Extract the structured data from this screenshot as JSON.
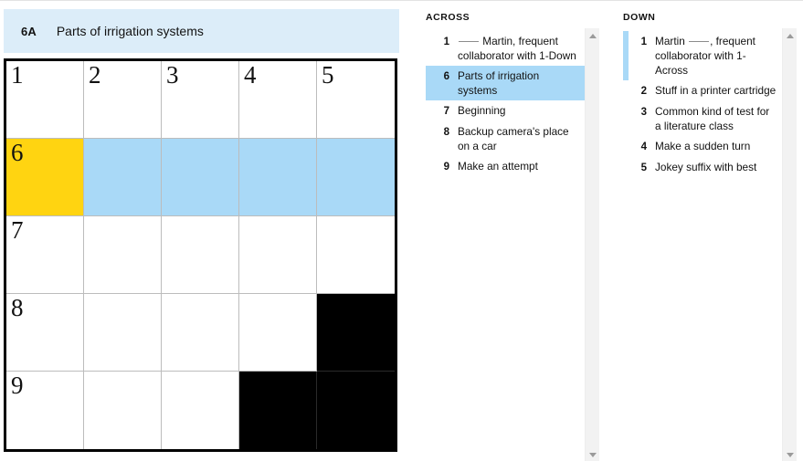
{
  "banner": {
    "number": "6A",
    "text": "Parts of irrigation systems"
  },
  "grid": {
    "rows": 5,
    "cols": 5,
    "cursor_color": "#FFD411",
    "word_highlight_color": "#A9D9F7",
    "block_color": "#000000",
    "cells": [
      [
        {
          "num": "1",
          "state": "open",
          "letter": ""
        },
        {
          "num": "2",
          "state": "open",
          "letter": ""
        },
        {
          "num": "3",
          "state": "open",
          "letter": ""
        },
        {
          "num": "4",
          "state": "open",
          "letter": ""
        },
        {
          "num": "5",
          "state": "open",
          "letter": ""
        }
      ],
      [
        {
          "num": "6",
          "state": "cursor",
          "letter": ""
        },
        {
          "num": "",
          "state": "word",
          "letter": ""
        },
        {
          "num": "",
          "state": "word",
          "letter": ""
        },
        {
          "num": "",
          "state": "word",
          "letter": ""
        },
        {
          "num": "",
          "state": "word",
          "letter": ""
        }
      ],
      [
        {
          "num": "7",
          "state": "open",
          "letter": ""
        },
        {
          "num": "",
          "state": "open",
          "letter": ""
        },
        {
          "num": "",
          "state": "open",
          "letter": ""
        },
        {
          "num": "",
          "state": "open",
          "letter": ""
        },
        {
          "num": "",
          "state": "open",
          "letter": ""
        }
      ],
      [
        {
          "num": "8",
          "state": "open",
          "letter": ""
        },
        {
          "num": "",
          "state": "open",
          "letter": ""
        },
        {
          "num": "",
          "state": "open",
          "letter": ""
        },
        {
          "num": "",
          "state": "open",
          "letter": ""
        },
        {
          "num": "",
          "state": "block",
          "letter": ""
        }
      ],
      [
        {
          "num": "9",
          "state": "open",
          "letter": ""
        },
        {
          "num": "",
          "state": "open",
          "letter": ""
        },
        {
          "num": "",
          "state": "open",
          "letter": ""
        },
        {
          "num": "",
          "state": "block",
          "letter": ""
        },
        {
          "num": "",
          "state": "block",
          "letter": ""
        }
      ]
    ]
  },
  "across": {
    "heading": "ACROSS",
    "clues": [
      {
        "num": "1",
        "text": "Martin, frequent collaborator with 1-Down",
        "leading_blank": true,
        "selected": false,
        "cross_ref": false
      },
      {
        "num": "6",
        "text": "Parts of irrigation systems",
        "leading_blank": false,
        "selected": true,
        "cross_ref": false
      },
      {
        "num": "7",
        "text": "Beginning",
        "leading_blank": false,
        "selected": false,
        "cross_ref": false
      },
      {
        "num": "8",
        "text": "Backup camera's place on a car",
        "leading_blank": false,
        "selected": false,
        "cross_ref": false
      },
      {
        "num": "9",
        "text": "Make an attempt",
        "leading_blank": false,
        "selected": false,
        "cross_ref": false
      }
    ]
  },
  "down": {
    "heading": "DOWN",
    "clues": [
      {
        "num": "1",
        "text": "Martin ___, frequent collaborator with 1-Across",
        "leading_blank": false,
        "selected": false,
        "cross_ref": true
      },
      {
        "num": "2",
        "text": "Stuff in a printer cartridge",
        "leading_blank": false,
        "selected": false,
        "cross_ref": false
      },
      {
        "num": "3",
        "text": "Common kind of test for a literature class",
        "leading_blank": false,
        "selected": false,
        "cross_ref": false
      },
      {
        "num": "4",
        "text": "Make a sudden turn",
        "leading_blank": false,
        "selected": false,
        "cross_ref": false
      },
      {
        "num": "5",
        "text": "Jokey suffix with best",
        "leading_blank": false,
        "selected": false,
        "cross_ref": false
      }
    ]
  },
  "scrollbars": {
    "across": {
      "up_icon": "caret-up-icon",
      "down_icon": "caret-down-icon"
    },
    "down": {
      "up_icon": "caret-up-icon",
      "down_icon": "caret-down-icon"
    }
  }
}
